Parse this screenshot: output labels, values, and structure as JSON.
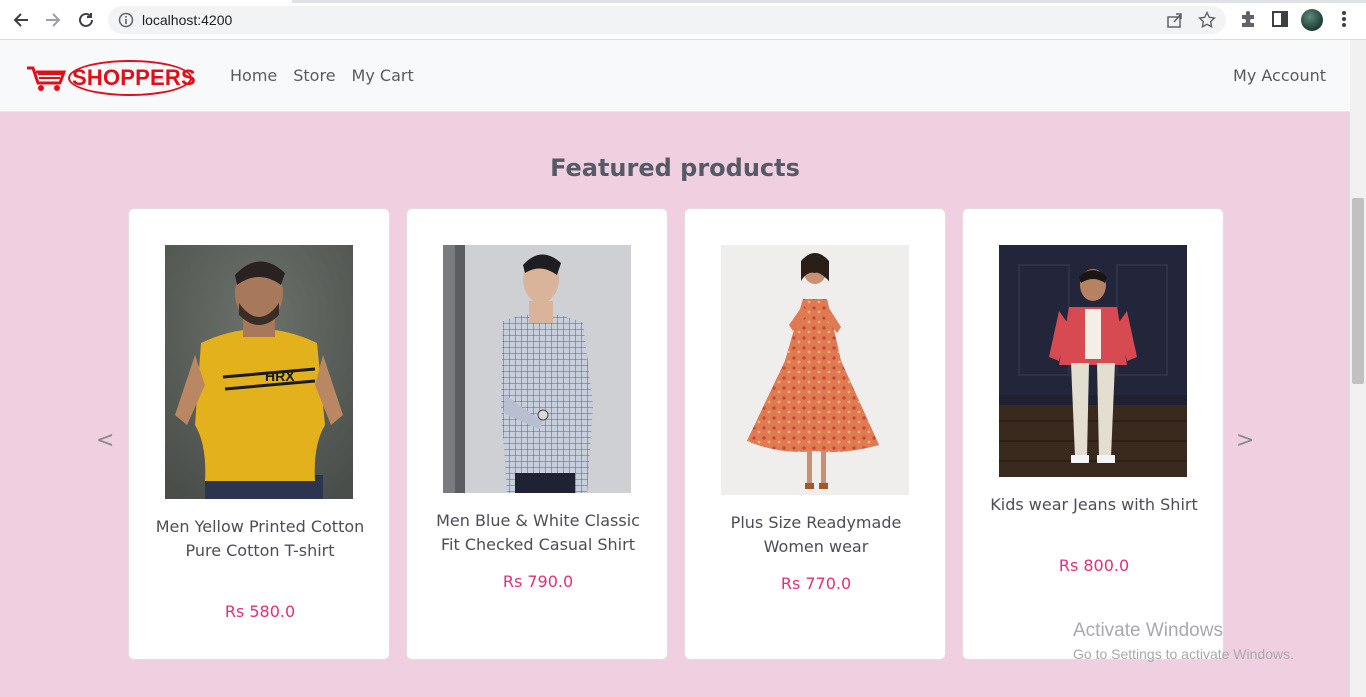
{
  "browser": {
    "url": "localhost:4200",
    "icons": [
      "back-arrow-icon",
      "forward-arrow-icon",
      "reload-icon",
      "info-icon",
      "share-icon",
      "star-icon",
      "extensions-icon",
      "sidepanel-icon",
      "profile-avatar",
      "kebab-menu-icon"
    ]
  },
  "header": {
    "logo_text": "SHOPPERS",
    "nav": [
      "Home",
      "Store",
      "My Cart"
    ],
    "account": "My Account"
  },
  "main": {
    "title": "Featured products",
    "prev_arrow": "<",
    "next_arrow": ">",
    "products": [
      {
        "name": "Men Yellow Printed Cotton Pure Cotton T-shirt",
        "price": "Rs 580.0",
        "image": "man-in-yellow-tshirt"
      },
      {
        "name": "Men Blue & White Classic Fit Checked Casual Shirt",
        "price": "Rs 790.0",
        "image": "man-in-checked-shirt"
      },
      {
        "name": "Plus Size Readymade Women wear",
        "price": "Rs 770.0",
        "image": "woman-in-floral-dress"
      },
      {
        "name": "Kids wear Jeans with Shirt",
        "price": "Rs 800.0",
        "image": "boy-in-red-jacket"
      }
    ]
  },
  "watermark": {
    "line1": "Activate Windows",
    "line2": "Go to Settings to activate Windows."
  },
  "colors": {
    "page_bg": "#f0d0e0",
    "price": "#e0307a",
    "logo_red": "#e0101b"
  }
}
